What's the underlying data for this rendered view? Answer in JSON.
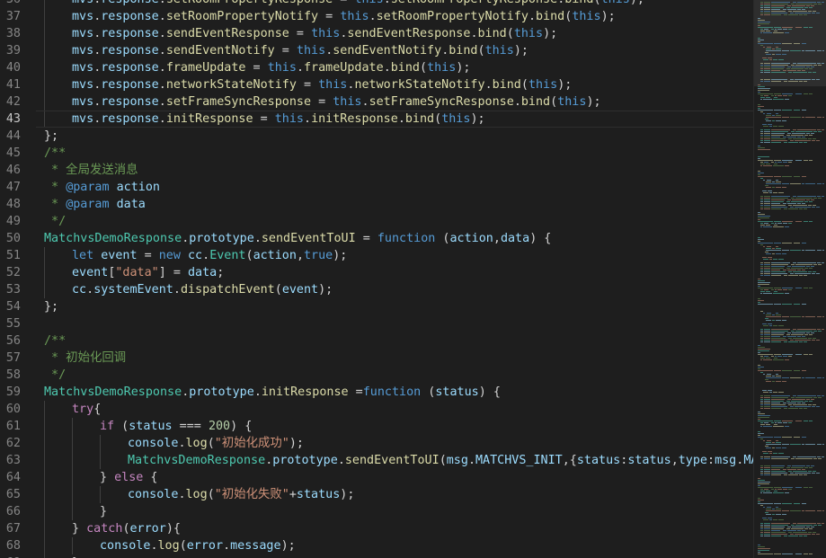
{
  "colors": {
    "background": "#1e1e1e",
    "line_number": "#858585",
    "keyword": "#569cd6",
    "control": "#c586c0",
    "variable": "#9cdcfe",
    "function": "#dcdcaa",
    "class": "#4ec9b0",
    "string": "#ce9178",
    "number": "#b5cea8",
    "comment": "#6a9955"
  },
  "editor": {
    "current_line": "43",
    "lines": [
      {
        "n": "36",
        "indent": 1,
        "tokens": [
          [
            "var",
            "mvs"
          ],
          [
            "plain",
            "."
          ],
          [
            "var",
            "response"
          ],
          [
            "plain",
            "."
          ],
          [
            "fn",
            "setRoomPropertyResponse"
          ],
          [
            "plain",
            " = "
          ],
          [
            "kw",
            "this"
          ],
          [
            "plain",
            "."
          ],
          [
            "fn",
            "setRoomPropertyResponse"
          ],
          [
            "plain",
            "."
          ],
          [
            "fn",
            "bind"
          ],
          [
            "plain",
            "("
          ],
          [
            "kw",
            "this"
          ],
          [
            "plain",
            ");"
          ]
        ]
      },
      {
        "n": "37",
        "indent": 1,
        "tokens": [
          [
            "var",
            "mvs"
          ],
          [
            "plain",
            "."
          ],
          [
            "var",
            "response"
          ],
          [
            "plain",
            "."
          ],
          [
            "fn",
            "setRoomPropertyNotify"
          ],
          [
            "plain",
            " = "
          ],
          [
            "kw",
            "this"
          ],
          [
            "plain",
            "."
          ],
          [
            "fn",
            "setRoomPropertyNotify"
          ],
          [
            "plain",
            "."
          ],
          [
            "fn",
            "bind"
          ],
          [
            "plain",
            "("
          ],
          [
            "kw",
            "this"
          ],
          [
            "plain",
            ");"
          ]
        ]
      },
      {
        "n": "38",
        "indent": 1,
        "tokens": [
          [
            "var",
            "mvs"
          ],
          [
            "plain",
            "."
          ],
          [
            "var",
            "response"
          ],
          [
            "plain",
            "."
          ],
          [
            "fn",
            "sendEventResponse"
          ],
          [
            "plain",
            " = "
          ],
          [
            "kw",
            "this"
          ],
          [
            "plain",
            "."
          ],
          [
            "fn",
            "sendEventResponse"
          ],
          [
            "plain",
            "."
          ],
          [
            "fn",
            "bind"
          ],
          [
            "plain",
            "("
          ],
          [
            "kw",
            "this"
          ],
          [
            "plain",
            ");"
          ]
        ]
      },
      {
        "n": "39",
        "indent": 1,
        "tokens": [
          [
            "var",
            "mvs"
          ],
          [
            "plain",
            "."
          ],
          [
            "var",
            "response"
          ],
          [
            "plain",
            "."
          ],
          [
            "fn",
            "sendEventNotify"
          ],
          [
            "plain",
            " = "
          ],
          [
            "kw",
            "this"
          ],
          [
            "plain",
            "."
          ],
          [
            "fn",
            "sendEventNotify"
          ],
          [
            "plain",
            "."
          ],
          [
            "fn",
            "bind"
          ],
          [
            "plain",
            "("
          ],
          [
            "kw",
            "this"
          ],
          [
            "plain",
            ");"
          ]
        ]
      },
      {
        "n": "40",
        "indent": 1,
        "tokens": [
          [
            "var",
            "mvs"
          ],
          [
            "plain",
            "."
          ],
          [
            "var",
            "response"
          ],
          [
            "plain",
            "."
          ],
          [
            "fn",
            "frameUpdate"
          ],
          [
            "plain",
            " = "
          ],
          [
            "kw",
            "this"
          ],
          [
            "plain",
            "."
          ],
          [
            "fn",
            "frameUpdate"
          ],
          [
            "plain",
            "."
          ],
          [
            "fn",
            "bind"
          ],
          [
            "plain",
            "("
          ],
          [
            "kw",
            "this"
          ],
          [
            "plain",
            ");"
          ]
        ]
      },
      {
        "n": "41",
        "indent": 1,
        "tokens": [
          [
            "var",
            "mvs"
          ],
          [
            "plain",
            "."
          ],
          [
            "var",
            "response"
          ],
          [
            "plain",
            "."
          ],
          [
            "fn",
            "networkStateNotify"
          ],
          [
            "plain",
            " = "
          ],
          [
            "kw",
            "this"
          ],
          [
            "plain",
            "."
          ],
          [
            "fn",
            "networkStateNotify"
          ],
          [
            "plain",
            "."
          ],
          [
            "fn",
            "bind"
          ],
          [
            "plain",
            "("
          ],
          [
            "kw",
            "this"
          ],
          [
            "plain",
            ");"
          ]
        ]
      },
      {
        "n": "42",
        "indent": 1,
        "tokens": [
          [
            "var",
            "mvs"
          ],
          [
            "plain",
            "."
          ],
          [
            "var",
            "response"
          ],
          [
            "plain",
            "."
          ],
          [
            "fn",
            "setFrameSyncResponse"
          ],
          [
            "plain",
            " = "
          ],
          [
            "kw",
            "this"
          ],
          [
            "plain",
            "."
          ],
          [
            "fn",
            "setFrameSyncResponse"
          ],
          [
            "plain",
            "."
          ],
          [
            "fn",
            "bind"
          ],
          [
            "plain",
            "("
          ],
          [
            "kw",
            "this"
          ],
          [
            "plain",
            ");"
          ]
        ]
      },
      {
        "n": "43",
        "indent": 1,
        "tokens": [
          [
            "var",
            "mvs"
          ],
          [
            "plain",
            "."
          ],
          [
            "var",
            "response"
          ],
          [
            "plain",
            "."
          ],
          [
            "fn",
            "initResponse"
          ],
          [
            "plain",
            " = "
          ],
          [
            "kw",
            "this"
          ],
          [
            "plain",
            "."
          ],
          [
            "fn",
            "initResponse"
          ],
          [
            "plain",
            "."
          ],
          [
            "fn",
            "bind"
          ],
          [
            "plain",
            "("
          ],
          [
            "kw",
            "this"
          ],
          [
            "plain",
            ");"
          ]
        ]
      },
      {
        "n": "44",
        "indent": 0,
        "tokens": [
          [
            "plain",
            "};"
          ]
        ]
      },
      {
        "n": "45",
        "indent": 0,
        "tokens": [
          [
            "cmt",
            "/**"
          ]
        ]
      },
      {
        "n": "46",
        "indent": 0,
        "tokens": [
          [
            "cmt",
            " * 全局发送消息"
          ]
        ]
      },
      {
        "n": "47",
        "indent": 0,
        "tokens": [
          [
            "cmt",
            " * "
          ],
          [
            "tag",
            "@param"
          ],
          [
            "cmt",
            " "
          ],
          [
            "var",
            "action"
          ]
        ]
      },
      {
        "n": "48",
        "indent": 0,
        "tokens": [
          [
            "cmt",
            " * "
          ],
          [
            "tag",
            "@param"
          ],
          [
            "cmt",
            " "
          ],
          [
            "var",
            "data"
          ]
        ]
      },
      {
        "n": "49",
        "indent": 0,
        "tokens": [
          [
            "cmt",
            " */"
          ]
        ]
      },
      {
        "n": "50",
        "indent": 0,
        "tokens": [
          [
            "cls",
            "MatchvsDemoResponse"
          ],
          [
            "plain",
            "."
          ],
          [
            "var",
            "prototype"
          ],
          [
            "plain",
            "."
          ],
          [
            "fn",
            "sendEventToUI"
          ],
          [
            "plain",
            " = "
          ],
          [
            "kw",
            "function"
          ],
          [
            "plain",
            " ("
          ],
          [
            "var",
            "action"
          ],
          [
            "plain",
            ","
          ],
          [
            "var",
            "data"
          ],
          [
            "plain",
            ") {"
          ]
        ]
      },
      {
        "n": "51",
        "indent": 1,
        "tokens": [
          [
            "kw",
            "let"
          ],
          [
            "plain",
            " "
          ],
          [
            "var",
            "event"
          ],
          [
            "plain",
            " = "
          ],
          [
            "kw",
            "new"
          ],
          [
            "plain",
            " "
          ],
          [
            "var",
            "cc"
          ],
          [
            "plain",
            "."
          ],
          [
            "cls",
            "Event"
          ],
          [
            "plain",
            "("
          ],
          [
            "var",
            "action"
          ],
          [
            "plain",
            ","
          ],
          [
            "kw",
            "true"
          ],
          [
            "plain",
            ");"
          ]
        ]
      },
      {
        "n": "52",
        "indent": 1,
        "tokens": [
          [
            "var",
            "event"
          ],
          [
            "plain",
            "["
          ],
          [
            "str",
            "\"data\""
          ],
          [
            "plain",
            "] = "
          ],
          [
            "var",
            "data"
          ],
          [
            "plain",
            ";"
          ]
        ]
      },
      {
        "n": "53",
        "indent": 1,
        "tokens": [
          [
            "var",
            "cc"
          ],
          [
            "plain",
            "."
          ],
          [
            "var",
            "systemEvent"
          ],
          [
            "plain",
            "."
          ],
          [
            "fn",
            "dispatchEvent"
          ],
          [
            "plain",
            "("
          ],
          [
            "var",
            "event"
          ],
          [
            "plain",
            ");"
          ]
        ]
      },
      {
        "n": "54",
        "indent": 0,
        "tokens": [
          [
            "plain",
            "};"
          ]
        ]
      },
      {
        "n": "55",
        "indent": 0,
        "tokens": []
      },
      {
        "n": "56",
        "indent": 0,
        "tokens": [
          [
            "cmt",
            "/**"
          ]
        ]
      },
      {
        "n": "57",
        "indent": 0,
        "tokens": [
          [
            "cmt",
            " * 初始化回调"
          ]
        ]
      },
      {
        "n": "58",
        "indent": 0,
        "tokens": [
          [
            "cmt",
            " */"
          ]
        ]
      },
      {
        "n": "59",
        "indent": 0,
        "tokens": [
          [
            "cls",
            "MatchvsDemoResponse"
          ],
          [
            "plain",
            "."
          ],
          [
            "var",
            "prototype"
          ],
          [
            "plain",
            "."
          ],
          [
            "fn",
            "initResponse"
          ],
          [
            "plain",
            " ="
          ],
          [
            "kw",
            "function"
          ],
          [
            "plain",
            " ("
          ],
          [
            "var",
            "status"
          ],
          [
            "plain",
            ") {"
          ]
        ]
      },
      {
        "n": "60",
        "indent": 1,
        "tokens": [
          [
            "ctl",
            "try"
          ],
          [
            "plain",
            "{"
          ]
        ]
      },
      {
        "n": "61",
        "indent": 2,
        "tokens": [
          [
            "ctl",
            "if"
          ],
          [
            "plain",
            " ("
          ],
          [
            "var",
            "status"
          ],
          [
            "plain",
            " === "
          ],
          [
            "num",
            "200"
          ],
          [
            "plain",
            ") {"
          ]
        ]
      },
      {
        "n": "62",
        "indent": 3,
        "tokens": [
          [
            "var",
            "console"
          ],
          [
            "plain",
            "."
          ],
          [
            "fn",
            "log"
          ],
          [
            "plain",
            "("
          ],
          [
            "str",
            "\"初始化成功\""
          ],
          [
            "plain",
            ");"
          ]
        ]
      },
      {
        "n": "63",
        "indent": 3,
        "tokens": [
          [
            "cls",
            "MatchvsDemoResponse"
          ],
          [
            "plain",
            "."
          ],
          [
            "var",
            "prototype"
          ],
          [
            "plain",
            "."
          ],
          [
            "fn",
            "sendEventToUI"
          ],
          [
            "plain",
            "("
          ],
          [
            "var",
            "msg"
          ],
          [
            "plain",
            "."
          ],
          [
            "var",
            "MATCHVS_INIT"
          ],
          [
            "plain",
            ",{"
          ],
          [
            "var",
            "status"
          ],
          [
            "plain",
            ":"
          ],
          [
            "var",
            "status"
          ],
          [
            "plain",
            ","
          ],
          [
            "var",
            "type"
          ],
          [
            "plain",
            ":"
          ],
          [
            "var",
            "msg"
          ],
          [
            "plain",
            "."
          ],
          [
            "var",
            "MATCHVS_INIT"
          ],
          [
            "plain",
            "});"
          ]
        ]
      },
      {
        "n": "64",
        "indent": 2,
        "tokens": [
          [
            "plain",
            "} "
          ],
          [
            "ctl",
            "else"
          ],
          [
            "plain",
            " {"
          ]
        ]
      },
      {
        "n": "65",
        "indent": 3,
        "tokens": [
          [
            "var",
            "console"
          ],
          [
            "plain",
            "."
          ],
          [
            "fn",
            "log"
          ],
          [
            "plain",
            "("
          ],
          [
            "str",
            "\"初始化失败\""
          ],
          [
            "plain",
            "+"
          ],
          [
            "var",
            "status"
          ],
          [
            "plain",
            ");"
          ]
        ]
      },
      {
        "n": "66",
        "indent": 2,
        "tokens": [
          [
            "plain",
            "}"
          ]
        ]
      },
      {
        "n": "67",
        "indent": 1,
        "tokens": [
          [
            "plain",
            "} "
          ],
          [
            "ctl",
            "catch"
          ],
          [
            "plain",
            "("
          ],
          [
            "var",
            "error"
          ],
          [
            "plain",
            "){"
          ]
        ]
      },
      {
        "n": "68",
        "indent": 2,
        "tokens": [
          [
            "var",
            "console"
          ],
          [
            "plain",
            "."
          ],
          [
            "fn",
            "log"
          ],
          [
            "plain",
            "("
          ],
          [
            "var",
            "error"
          ],
          [
            "plain",
            "."
          ],
          [
            "var",
            "message"
          ],
          [
            "plain",
            ");"
          ]
        ]
      },
      {
        "n": "69",
        "indent": 1,
        "tokens": [
          [
            "plain",
            "}"
          ]
        ]
      }
    ]
  }
}
